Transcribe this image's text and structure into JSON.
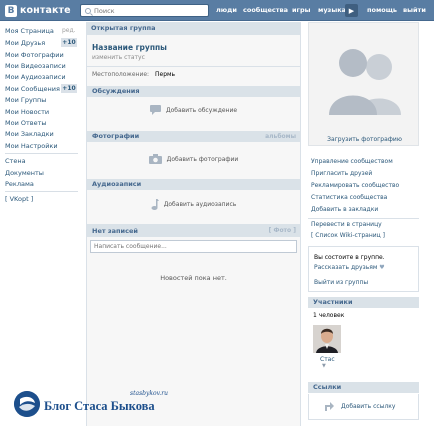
{
  "header": {
    "logo_letter": "B",
    "logo_text": "контакте",
    "search_placeholder": "Поиск",
    "nav": [
      "люди",
      "сообщества",
      "игры",
      "музыка",
      "помощь",
      "выйти"
    ]
  },
  "sidebar": {
    "edit_label": "ред.",
    "items": [
      {
        "label": "Моя Страница"
      },
      {
        "label": "Мои Друзья",
        "badge": "+10"
      },
      {
        "label": "Мои Фотографии"
      },
      {
        "label": "Мои Видеозаписи"
      },
      {
        "label": "Мои Аудиозаписи"
      },
      {
        "label": "Мои Сообщения",
        "badge": "+10"
      },
      {
        "label": "Мои Группы"
      },
      {
        "label": "Мои Новости"
      },
      {
        "label": "Мои Ответы"
      },
      {
        "label": "Мои Закладки"
      },
      {
        "label": "Мои Настройки"
      }
    ],
    "extra": [
      "Стена",
      "Документы",
      "Реклама"
    ],
    "vkopt": "[ VKopt ]"
  },
  "group": {
    "breadcrumb": "Открытая группа",
    "name": "Название группы",
    "status_hint": "изменить статус",
    "location_label": "Местоположение:",
    "location_value": "Пермь"
  },
  "sections": {
    "discussions": {
      "title": "Обсуждения",
      "action": "Добавить обсуждение"
    },
    "photos": {
      "title": "Фотографии",
      "right": "альбомы",
      "action": "Добавить фотографии"
    },
    "audio": {
      "title": "Аудиозаписи",
      "action": "Добавить аудиозапись"
    }
  },
  "wall": {
    "title": "Нет записей",
    "photo_link": "[ Фото ]",
    "placeholder": "Написать сообщение...",
    "empty": "Новостей пока нет."
  },
  "right": {
    "upload_photo": "Загрузить фотографию",
    "links": [
      "Управление сообществом",
      "Пригласить друзей",
      "Рекламировать сообщество",
      "Статистика сообщества",
      "Добавить в закладки"
    ],
    "links2": [
      "Перевести в страницу",
      "[ Список Wiki-страниц ]"
    ],
    "membership": {
      "status": "Вы состоите в группе.",
      "tell": "Рассказать друзьям",
      "leave": "Выйти из группы"
    },
    "members": {
      "title": "Участники",
      "count": "1 человек",
      "member_name": "Стас"
    },
    "links_box": {
      "title": "Ссылки",
      "add": "Добавить ссылку"
    }
  },
  "watermark": {
    "site": "stasbykov.ru",
    "name": "Блог Стаса Быкова"
  },
  "colors": {
    "header": "#597da3",
    "link": "#2b587a",
    "section_bg": "#dae2e8",
    "watermark": "#1d4f8c"
  }
}
